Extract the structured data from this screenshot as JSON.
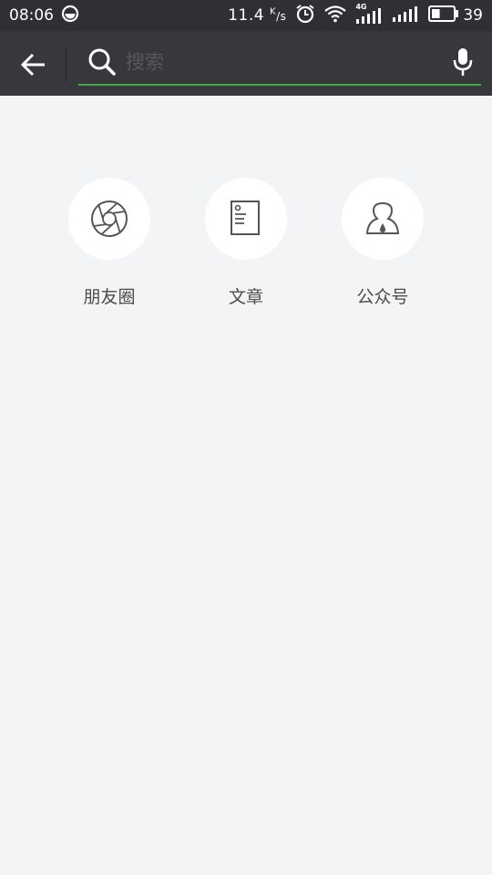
{
  "status_bar": {
    "time": "08:06",
    "speed_value": "11.4",
    "speed_unit_top": "K",
    "speed_unit_bottom": "/s",
    "network_label": "4G",
    "battery_level": "39"
  },
  "app_bar": {
    "search_placeholder": "搜索",
    "accent_color": "#48a84a"
  },
  "categories": [
    {
      "label": "朋友圈",
      "icon": "moments-aperture-icon"
    },
    {
      "label": "文章",
      "icon": "article-document-icon"
    },
    {
      "label": "公众号",
      "icon": "official-account-person-icon"
    }
  ]
}
